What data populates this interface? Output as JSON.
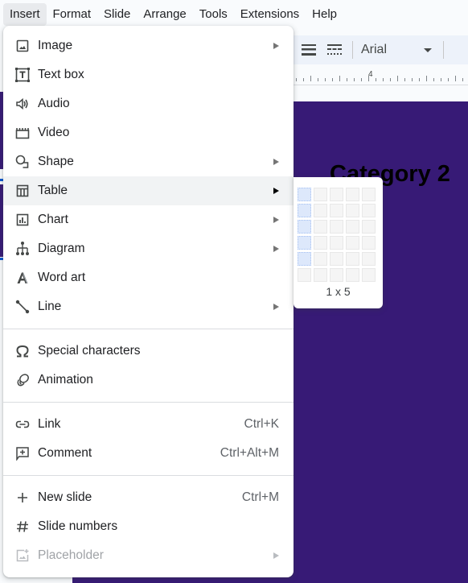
{
  "menubar": {
    "items": [
      {
        "label": "Insert",
        "active": true
      },
      {
        "label": "Format"
      },
      {
        "label": "Slide"
      },
      {
        "label": "Arrange"
      },
      {
        "label": "Tools"
      },
      {
        "label": "Extensions"
      },
      {
        "label": "Help"
      }
    ]
  },
  "toolbar": {
    "font_name": "Arial",
    "icons": [
      "line-weight-icon",
      "line-dash-icon"
    ]
  },
  "ruler": {
    "mark": "4"
  },
  "slide": {
    "title": "Category 2",
    "background_color": "#371a76"
  },
  "insert_menu": {
    "groups": [
      [
        {
          "label": "Image",
          "icon": "image-icon",
          "submenu": true
        },
        {
          "label": "Text box",
          "icon": "text-box-icon"
        },
        {
          "label": "Audio",
          "icon": "audio-icon"
        },
        {
          "label": "Video",
          "icon": "video-icon"
        },
        {
          "label": "Shape",
          "icon": "shape-icon",
          "submenu": true
        },
        {
          "label": "Table",
          "icon": "table-icon",
          "submenu": true,
          "hover": true
        },
        {
          "label": "Chart",
          "icon": "chart-icon",
          "submenu": true
        },
        {
          "label": "Diagram",
          "icon": "diagram-icon",
          "submenu": true
        },
        {
          "label": "Word art",
          "icon": "word-art-icon"
        },
        {
          "label": "Line",
          "icon": "line-icon",
          "submenu": true
        }
      ],
      [
        {
          "label": "Special characters",
          "icon": "omega-icon"
        },
        {
          "label": "Animation",
          "icon": "animation-icon"
        }
      ],
      [
        {
          "label": "Link",
          "icon": "link-icon",
          "shortcut": "Ctrl+K"
        },
        {
          "label": "Comment",
          "icon": "comment-icon",
          "shortcut": "Ctrl+Alt+M"
        }
      ],
      [
        {
          "label": "New slide",
          "icon": "plus-icon",
          "shortcut": "Ctrl+M"
        },
        {
          "label": "Slide numbers",
          "icon": "hash-icon"
        },
        {
          "label": "Placeholder",
          "icon": "placeholder-icon",
          "submenu": true,
          "disabled": true
        }
      ]
    ]
  },
  "table_submenu": {
    "columns": 5,
    "rows": 6,
    "selected_columns": 1,
    "selected_rows": 5,
    "size_label": "1 x 5"
  }
}
